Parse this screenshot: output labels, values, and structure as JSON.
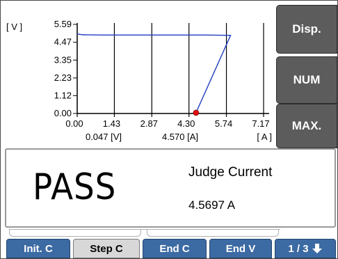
{
  "graph": {
    "y_unit": "[ V ]",
    "x_unit": "[ A ]",
    "y_ticks": [
      "5.59",
      "4.47",
      "3.35",
      "2.23",
      "1.12",
      "0.00"
    ],
    "x_ticks": [
      "0.00",
      "1.43",
      "2.87",
      "4.30",
      "5.74",
      "7.17"
    ],
    "cursor_voltage": "0.047 [V]",
    "cursor_current": "4.570 [A]",
    "trace_color": "#1f3fbf",
    "marker_color": "#e01010"
  },
  "chart_data": {
    "type": "line",
    "xlabel": "[ A ]",
    "ylabel": "[ V ]",
    "xlim": [
      0.0,
      7.17
    ],
    "ylim": [
      0.0,
      5.59
    ],
    "x_ticks": [
      0.0,
      1.43,
      2.87,
      4.3,
      5.74,
      7.17
    ],
    "y_ticks": [
      0.0,
      1.12,
      2.23,
      3.35,
      4.47,
      5.59
    ],
    "series": [
      {
        "x": [
          0.0,
          0.2,
          1.0,
          2.0,
          3.0,
          4.0,
          5.0,
          5.9,
          4.57
        ],
        "y": [
          4.99,
          4.94,
          4.92,
          4.92,
          4.92,
          4.92,
          4.92,
          4.9,
          0.047
        ]
      }
    ],
    "marker": {
      "x": 4.57,
      "y": 0.047
    },
    "grid": "vertical"
  },
  "side_keys": {
    "disp": "Disp.",
    "num": "NUM",
    "max": "MAX."
  },
  "result": {
    "status": "PASS",
    "judge_title": "Judge Current",
    "judge_value": "4.5697 A"
  },
  "bottom_keys": {
    "init": "Init. C",
    "step": "Step C",
    "end_c": "End C",
    "end_v": "End V",
    "page": "1 / 3",
    "page_icon": "arrow-down-icon"
  }
}
